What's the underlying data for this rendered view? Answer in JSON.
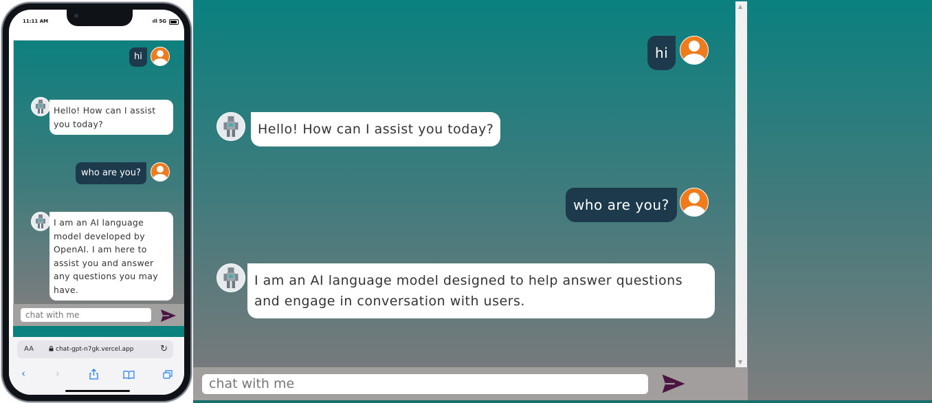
{
  "mobile": {
    "status": {
      "time": "11:11 AM",
      "network": "5G"
    },
    "messages": [
      {
        "role": "user",
        "text": "hi"
      },
      {
        "role": "bot",
        "lines": [
          "Hello! How can I assist",
          "you today?"
        ]
      },
      {
        "role": "user",
        "text": "who are you?"
      },
      {
        "role": "bot",
        "lines": [
          "I am an AI language",
          "model developed by",
          "OpenAI. I am here to",
          "assist you and answer",
          "any questions you may",
          "have."
        ]
      }
    ],
    "input_placeholder": "chat with me",
    "browser": {
      "aa_label": "AA",
      "url": "chat-gpt-n7gk.vercel.app",
      "reload_icon": "reload-icon",
      "nav_icons": [
        "back-icon",
        "forward-icon",
        "share-icon",
        "bookmarks-icon",
        "tabs-icon"
      ]
    }
  },
  "desktop": {
    "messages": [
      {
        "role": "user",
        "text": "hi"
      },
      {
        "role": "bot",
        "text": "Hello! How can I assist you today?"
      },
      {
        "role": "user",
        "text": "who are you?"
      },
      {
        "role": "bot",
        "lines": [
          "I am an AI language model designed to help answer questions",
          "and engage in conversation with users."
        ]
      }
    ],
    "input_placeholder": "chat with me"
  },
  "colors": {
    "teal": "#0a807f",
    "user_bubble": "#1c3a4c",
    "user_avatar": "#f07b1c",
    "input_bar": "#a39e9e",
    "send_icon": "#4a1540"
  }
}
